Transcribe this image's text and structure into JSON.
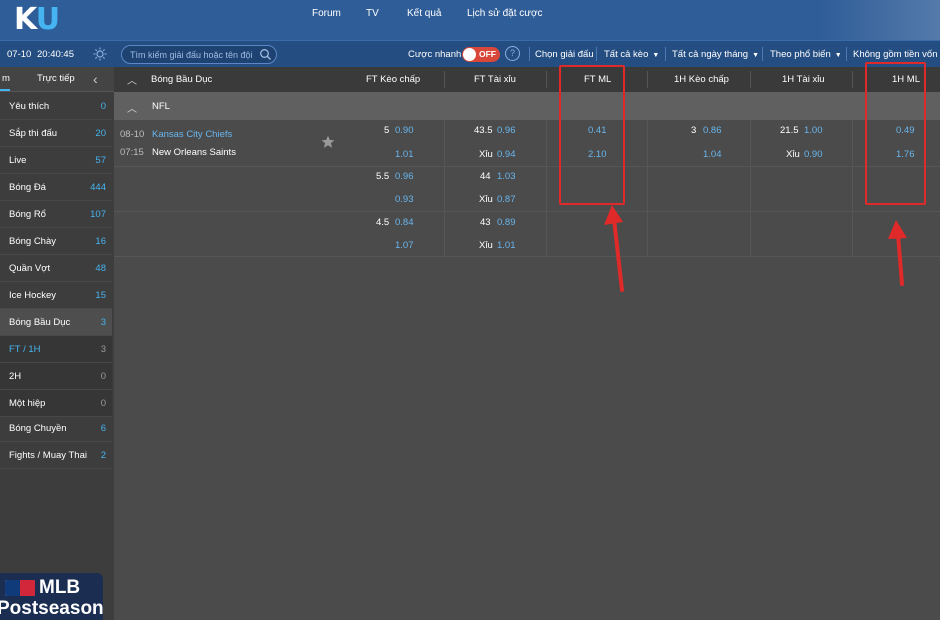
{
  "header": {
    "logo_main": "K",
    "logo_accent": "U",
    "nav": [
      "Forum",
      "TV",
      "Kết quả",
      "Lịch sử đặt cược"
    ]
  },
  "toolbar": {
    "date": "07-10",
    "time": "20:40:45",
    "search_placeholder": "Tìm kiếm giải đấu hoặc tên đội",
    "quick_bet_label": "Cược nhanh",
    "quick_bet_state": "OFF",
    "help": "?",
    "filters": [
      "Chọn giải đấu",
      "Tất cả kèo",
      "Tất cả ngày tháng",
      "Theo phổ biến",
      "Không gồm tiền vốn"
    ]
  },
  "sidebar": {
    "tab_partial": "m",
    "tab_live": "Trực tiếp",
    "back": "‹",
    "items": [
      {
        "label": "Yêu thích",
        "count": "0"
      },
      {
        "label": "Sắp thi đấu",
        "count": "20"
      },
      {
        "label": "Live",
        "count": "57"
      },
      {
        "label": "Bóng Đá",
        "count": "444"
      },
      {
        "label": "Bóng Rổ",
        "count": "107"
      },
      {
        "label": "Bóng Chày",
        "count": "16"
      },
      {
        "label": "Quần Vợt",
        "count": "48"
      },
      {
        "label": "Ice Hockey",
        "count": "15"
      },
      {
        "label": "Bóng Bầu Dục",
        "count": "3"
      },
      {
        "label": "FT / 1H",
        "count": "3"
      },
      {
        "label": "2H",
        "count": "0"
      },
      {
        "label": "Một hiệp",
        "count": "0"
      },
      {
        "label": "Bóng Chuyền",
        "count": "6"
      },
      {
        "label": "Fights / Muay Thai",
        "count": "2"
      }
    ],
    "banner_title": "MLB",
    "banner_sub": "Postseason"
  },
  "table": {
    "sport": "Bóng Bầu Dục",
    "columns": [
      "FT Kèo chấp",
      "FT Tài xỉu",
      "FT ML",
      "1H Kèo chấp",
      "1H Tài xỉu",
      "1H ML"
    ],
    "league": "NFL",
    "match": {
      "date": "08-10",
      "time": "07:15",
      "home": "Kansas City Chiefs",
      "away": "New Orleans Saints"
    },
    "rows": [
      {
        "hc_line": "5",
        "hc_odds": "0.90",
        "ou_line": "43.5",
        "ou_odds": "0.96",
        "ml": "0.41",
        "h1_hc_line": "3",
        "h1_hc_odds": "0.86",
        "h1_ou_line": "21.5",
        "h1_ou_odds": "1.00",
        "h1_ml": "0.49"
      },
      {
        "hc_line": "",
        "hc_odds": "1.01",
        "ou_line": "Xỉu",
        "ou_odds": "0.94",
        "ml": "2.10",
        "h1_hc_line": "",
        "h1_hc_odds": "1.04",
        "h1_ou_line": "Xỉu",
        "h1_ou_odds": "0.90",
        "h1_ml": "1.76"
      },
      {
        "hc_line": "5.5",
        "hc_odds": "0.96",
        "ou_line": "44",
        "ou_odds": "1.03"
      },
      {
        "hc_line": "",
        "hc_odds": "0.93",
        "ou_line": "Xỉu",
        "ou_odds": "0.87"
      },
      {
        "hc_line": "4.5",
        "hc_odds": "0.84",
        "ou_line": "43",
        "ou_odds": "0.89"
      },
      {
        "hc_line": "",
        "hc_odds": "1.07",
        "ou_line": "Xỉu",
        "ou_odds": "1.01"
      }
    ]
  },
  "colors": {
    "header_bg": "#2f5d98",
    "accent_blue": "#46b4f0",
    "odds_blue": "#69b6ee",
    "highlight_red": "#e02a2a",
    "toggle_red": "#d9473b"
  }
}
